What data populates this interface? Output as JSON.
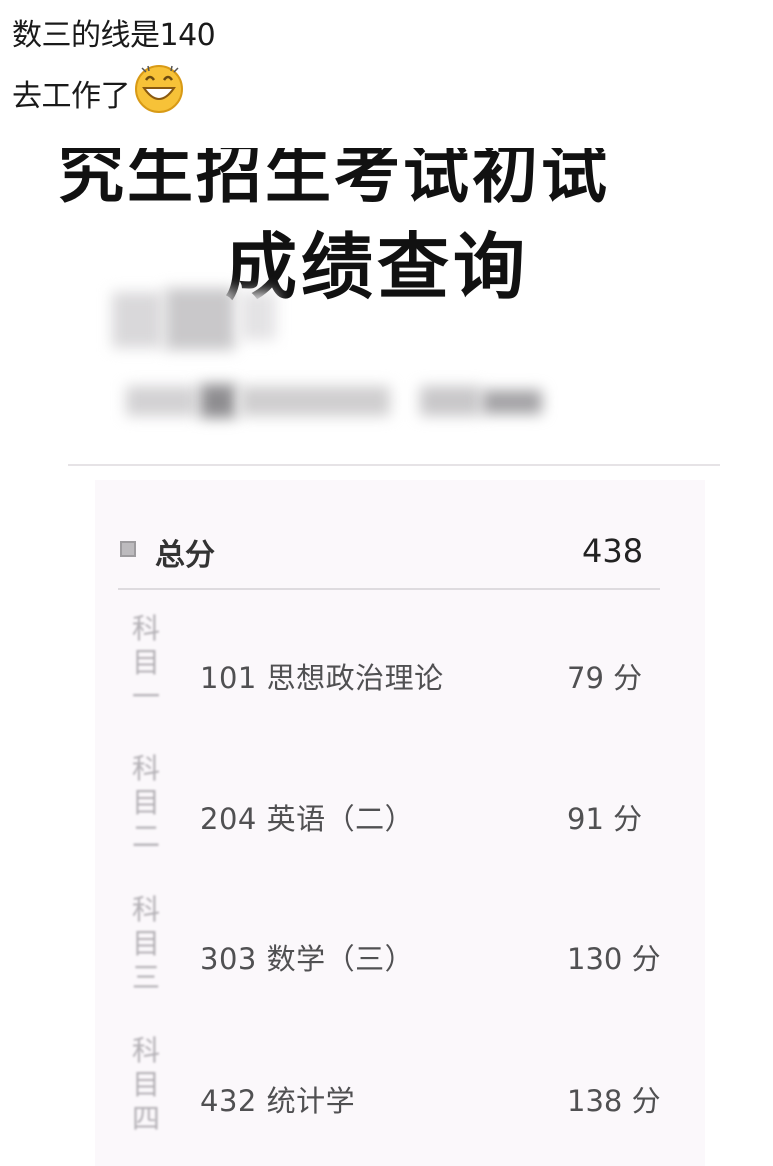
{
  "caption": {
    "line1": "数三的线是140",
    "line2": "去工作了"
  },
  "icons": {
    "emoji": "grinning-face-emoji"
  },
  "header": {
    "title_line1": "究生招生考试初试",
    "title_line2": "成绩查询"
  },
  "total": {
    "label": "总分",
    "value": "438"
  },
  "subjects": [
    {
      "side": "科目一",
      "name": "101 思想政治理论",
      "score": "79 分"
    },
    {
      "side": "科目二",
      "name": "204 英语（二）",
      "score": "91 分"
    },
    {
      "side": "科目三",
      "name": "303 数学（三）",
      "score": "130 分"
    },
    {
      "side": "科目四",
      "name": "432 统计学",
      "score": "138 分"
    }
  ],
  "colors": {
    "background": "#ffffff",
    "card": "#fbf8fb",
    "divider": "#dedbdf",
    "text_dark": "#111111",
    "text_muted": "#505052"
  }
}
